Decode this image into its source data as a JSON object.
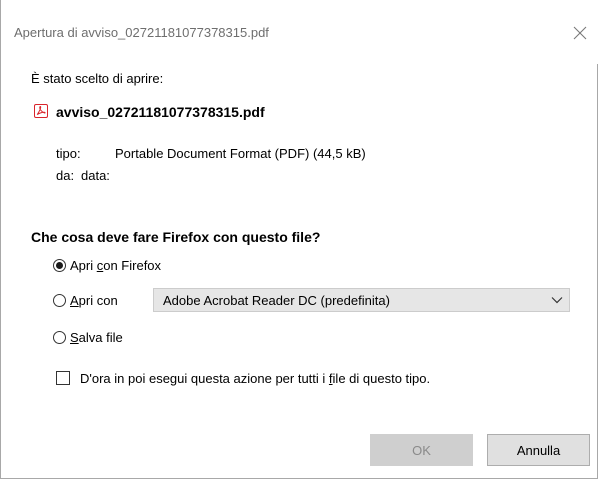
{
  "window": {
    "title": "Apertura di avviso_02721181077378315.pdf"
  },
  "file_info": {
    "intro": "È stato scelto di aprire:",
    "filename": "avviso_02721181077378315.pdf",
    "icon": "pdf-file-icon",
    "type_label": "tipo:",
    "type_value": "Portable Document Format (PDF) (44,5 kB)",
    "from_label": "da:",
    "from_value": "data:"
  },
  "action": {
    "question": "Che cosa deve fare Firefox con questo file?",
    "options": [
      {
        "pre": "Apri ",
        "underline": "c",
        "post": "on Firefox",
        "checked": true
      },
      {
        "pre": "",
        "underline": "A",
        "post": "pri con",
        "checked": false
      },
      {
        "pre": "",
        "underline": "S",
        "post": "alva file",
        "checked": false
      }
    ],
    "app_select_value": "Adobe Acrobat Reader DC (predefinita)",
    "remember": {
      "pre": "D'ora in poi esegui questa azione per tutti i ",
      "underline": "f",
      "post": "ile di questo tipo.",
      "checked": false
    }
  },
  "buttons": {
    "ok": "OK",
    "cancel": "Annulla",
    "ok_enabled": false
  },
  "colors": {
    "pdf_icon": "#d9242b",
    "title_text": "#6e6e6e",
    "ok_disabled_bg": "#cfcfcf"
  }
}
